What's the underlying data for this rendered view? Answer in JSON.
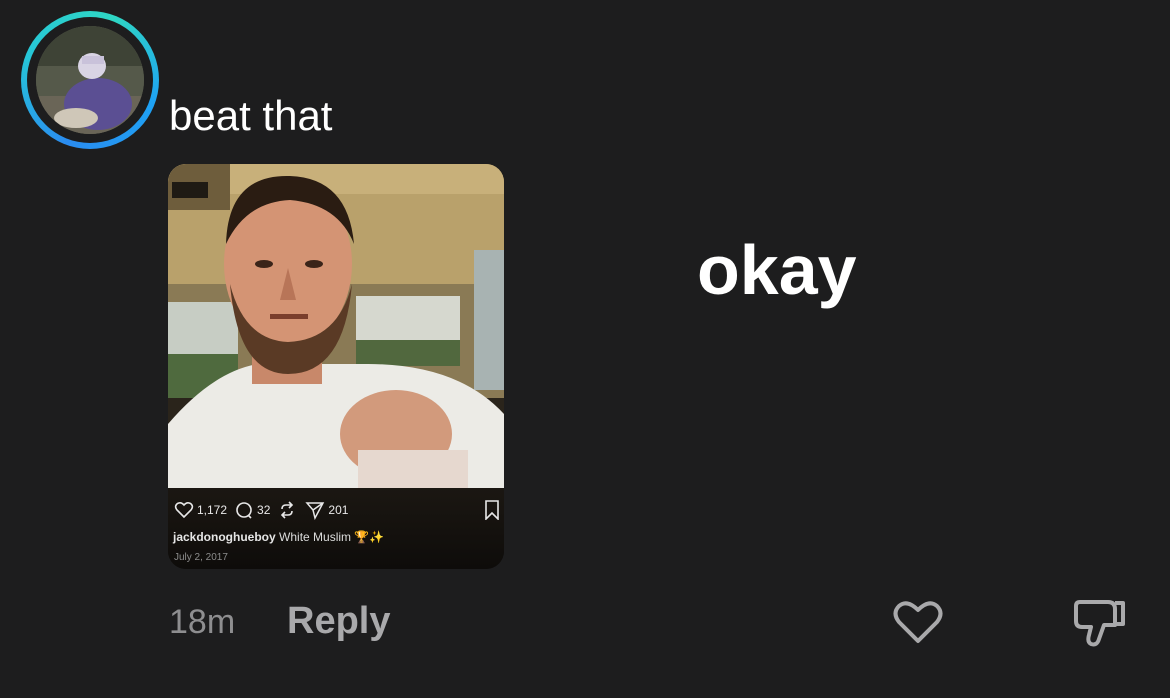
{
  "comment": {
    "text": "beat that",
    "timestamp": "18m",
    "reply_label": "Reply"
  },
  "overlay": {
    "word": "okay"
  },
  "attached_post": {
    "likes": "1,172",
    "comments": "32",
    "shares": "201",
    "username": "jackdonoghueboy",
    "caption": "White Muslim",
    "caption_emoji": "🏆✨",
    "date": "July 2, 2017"
  },
  "icons": {
    "like": "heart-icon",
    "dislike": "thumbs-down-icon"
  },
  "colors": {
    "background": "#1d1d1e",
    "avatar_ring_start": "#2a8cf0",
    "avatar_ring_end": "#2fd7c4",
    "muted_text": "#8e8e90"
  }
}
